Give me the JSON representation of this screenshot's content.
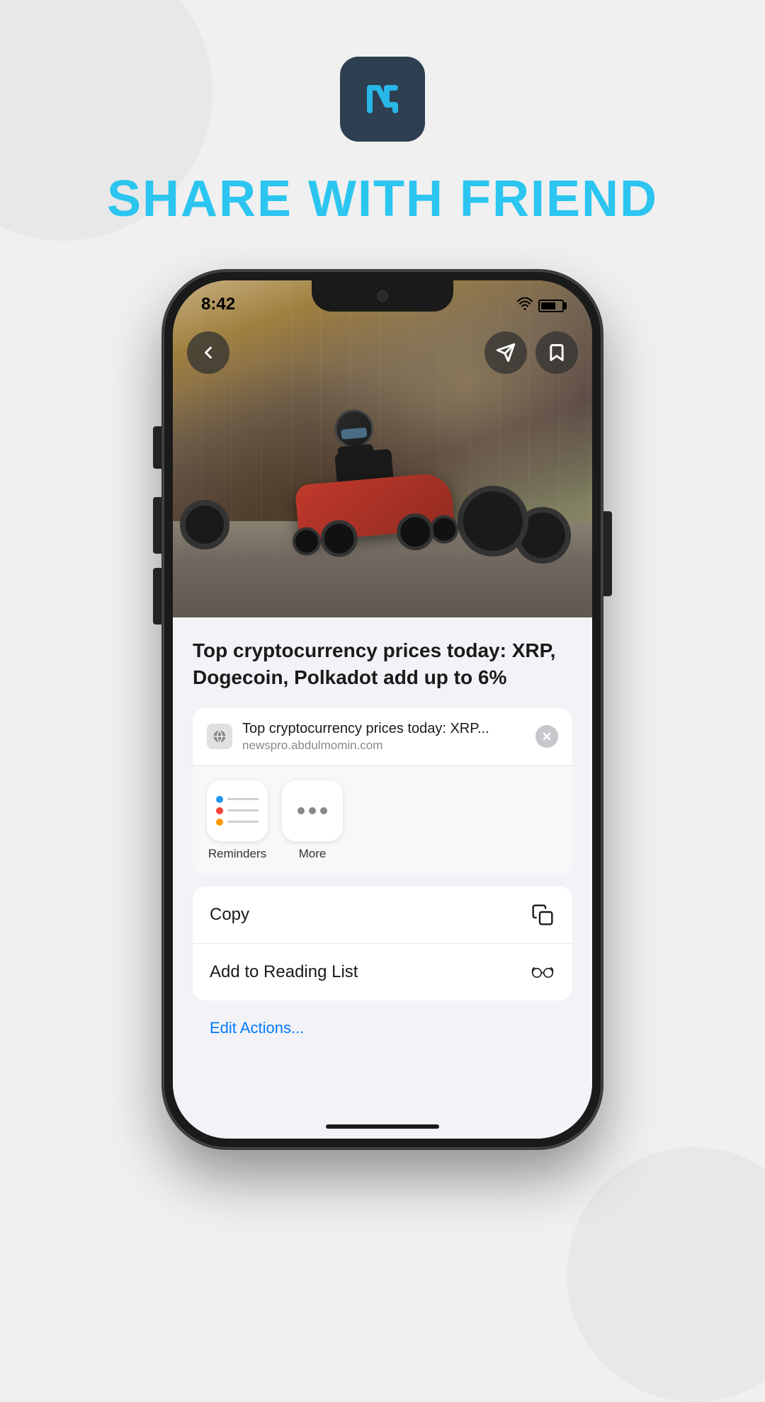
{
  "page": {
    "background_color": "#f0f0f0"
  },
  "header": {
    "app_icon_alt": "Newspro app icon",
    "title": "SHARE WITH FRIEND",
    "title_color": "#2bc5f0"
  },
  "phone": {
    "status_bar": {
      "time": "8:42",
      "wifi": true,
      "battery": true
    },
    "article": {
      "title": "Top cryptocurrency prices today: XRP, Dogecoin, Polkadot add up to 6%",
      "url_title": "Top cryptocurrency prices today: XRP...",
      "url_domain": "newspro.abdulmomin.com"
    },
    "share_sheet": {
      "close_button_label": "×",
      "actions": [
        {
          "id": "reminders",
          "label": "Reminders"
        },
        {
          "id": "more",
          "label": "More"
        }
      ],
      "list_items": [
        {
          "id": "copy",
          "label": "Copy",
          "icon": "copy-icon"
        },
        {
          "id": "add-reading-list",
          "label": "Add to Reading List",
          "icon": "glasses-icon"
        }
      ],
      "edit_actions_label": "Edit Actions..."
    },
    "nav": {
      "back_label": "‹",
      "share_label": "share",
      "bookmark_label": "bookmark"
    }
  }
}
